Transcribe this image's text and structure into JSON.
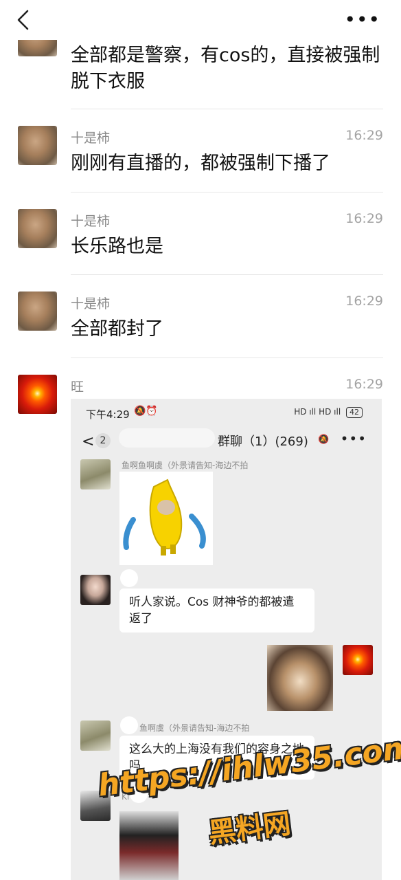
{
  "top_bar": {
    "more_label": "•••"
  },
  "messages": [
    {
      "sender": "",
      "time": "",
      "text": "全部都是警察，有cos的，直接被强制脱下衣服"
    },
    {
      "sender": "十是柿",
      "time": "16:29",
      "text": "刚刚有直播的，都被强制下播了"
    },
    {
      "sender": "十是柿",
      "time": "16:29",
      "text": "长乐路也是"
    },
    {
      "sender": "十是柿",
      "time": "16:29",
      "text": "全部都封了"
    },
    {
      "sender": "旺",
      "time": "16:29",
      "text": ""
    }
  ],
  "shot": {
    "status_time": "下午4:29",
    "status_icons": "🔕⏰",
    "status_right": "HD ıll HD ıll",
    "battery": "42",
    "back_arrow": "<",
    "badge": "2",
    "title": "群聊（1）(269)",
    "mute_icon": "🔕",
    "more": "•••",
    "items": [
      {
        "name": "鱼啊鱼啊虞（外景请告知-海边不拍",
        "bubble": ""
      },
      {
        "name": "",
        "bubble": "听人家说。Cos 财神爷的都被遣返了"
      },
      {
        "name": "鱼啊虞（外景请告知-海边不拍",
        "bubble": "这么大的上海没有我们的容身之地吗"
      },
      {
        "name": "Ki",
        "bubble": ""
      }
    ]
  },
  "watermark": {
    "line1": "https://ihlw35.com",
    "line2": "黑料网"
  }
}
